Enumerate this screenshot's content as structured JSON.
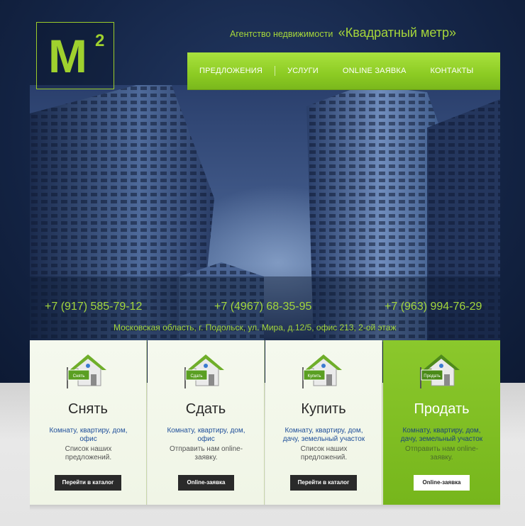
{
  "brand": {
    "logo_letter": "M",
    "logo_superscript": "2",
    "tagline": "Агентство недвижимости",
    "name": "«Квадратный метр»"
  },
  "nav": {
    "items": [
      {
        "label": "Предложения"
      },
      {
        "label": "Услуги"
      },
      {
        "label": "Online заявка"
      },
      {
        "label": "Контакты"
      }
    ]
  },
  "contacts": {
    "phones": [
      "+7 (917) 585-79-12",
      "+7 (4967) 68-35-95",
      "+7 (963) 994-76-29"
    ],
    "address": "Московская область, г. Подольск, ул. Мира, д.12/5, офис 213, 2-ой этаж"
  },
  "cards": [
    {
      "sign": "Снять",
      "title": "Снять",
      "link": "Комнату, квартиру, дом, офис",
      "desc": "Список наших предложений.",
      "button": "Перейти в каталог"
    },
    {
      "sign": "Сдать",
      "title": "Сдать",
      "link": "Комнату, квартиру, дом, офис",
      "desc": "Отправить нам online-заявку.",
      "button": "Online-заявка"
    },
    {
      "sign": "Купить",
      "title": "Купить",
      "link": "Комнату, квартиру, дом, дачу, земельный участок",
      "desc": "Список наших предложений.",
      "button": "Перейти в каталог"
    },
    {
      "sign": "Продать",
      "title": "Продать",
      "link": "Комнату, квартиру, дом, дачу, земельный участок",
      "desc": "Отправить нам online-заявку.",
      "button": "Online-заявка"
    }
  ],
  "colors": {
    "accent": "#8ccb23",
    "navy": "#152648",
    "link": "#1f4f9a"
  }
}
